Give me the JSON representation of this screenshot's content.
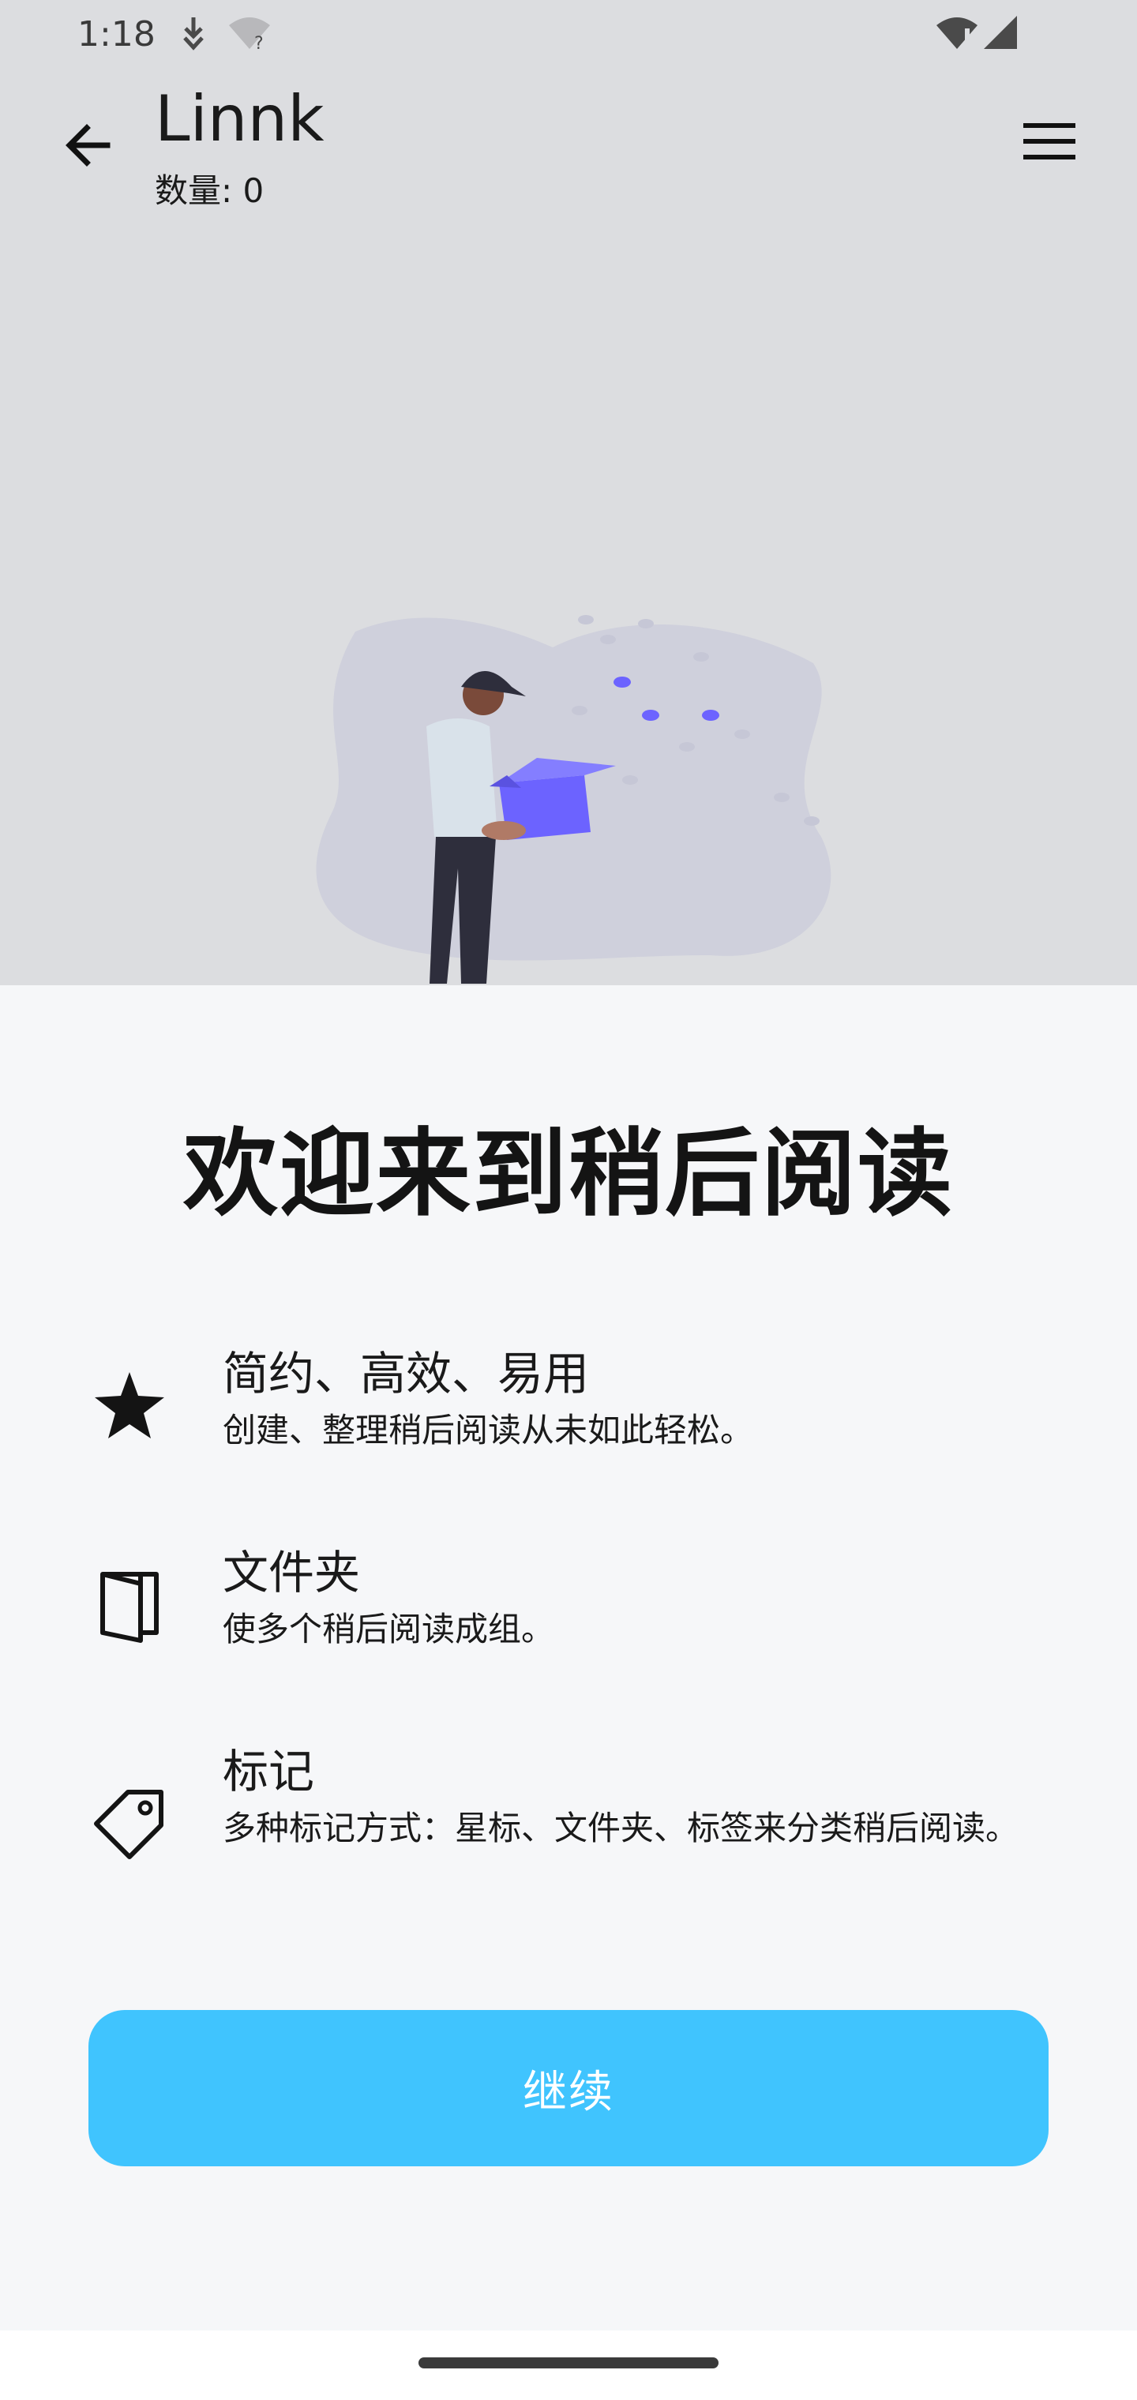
{
  "status_bar": {
    "time": "1:18",
    "icons": [
      "download-icon",
      "wifi-question-icon",
      "wifi-alert-icon",
      "cell-signal-icon"
    ]
  },
  "app_bar": {
    "back_icon": "arrow-back-icon",
    "title": "Linnk",
    "count_label": "数量: 0",
    "menu_icon": "hamburger-menu-icon"
  },
  "sheet": {
    "title": "欢迎来到稍后阅读",
    "features": [
      {
        "icon": "star-icon",
        "title": "简约、高效、易用",
        "description": "创建、整理稍后阅读从未如此轻松。"
      },
      {
        "icon": "folder-icon",
        "title": "文件夹",
        "description": "使多个稍后阅读成组。"
      },
      {
        "icon": "tag-icon",
        "title": "标记",
        "description": "多种标记方式：星标、文件夹、标签来分类稍后阅读。"
      }
    ],
    "continue_label": "继续"
  },
  "colors": {
    "backdrop": "#dcdde0",
    "sheet_background": "#f6f7f9",
    "button": "#40c4fe",
    "illustration_accent": "#6c63ff"
  }
}
